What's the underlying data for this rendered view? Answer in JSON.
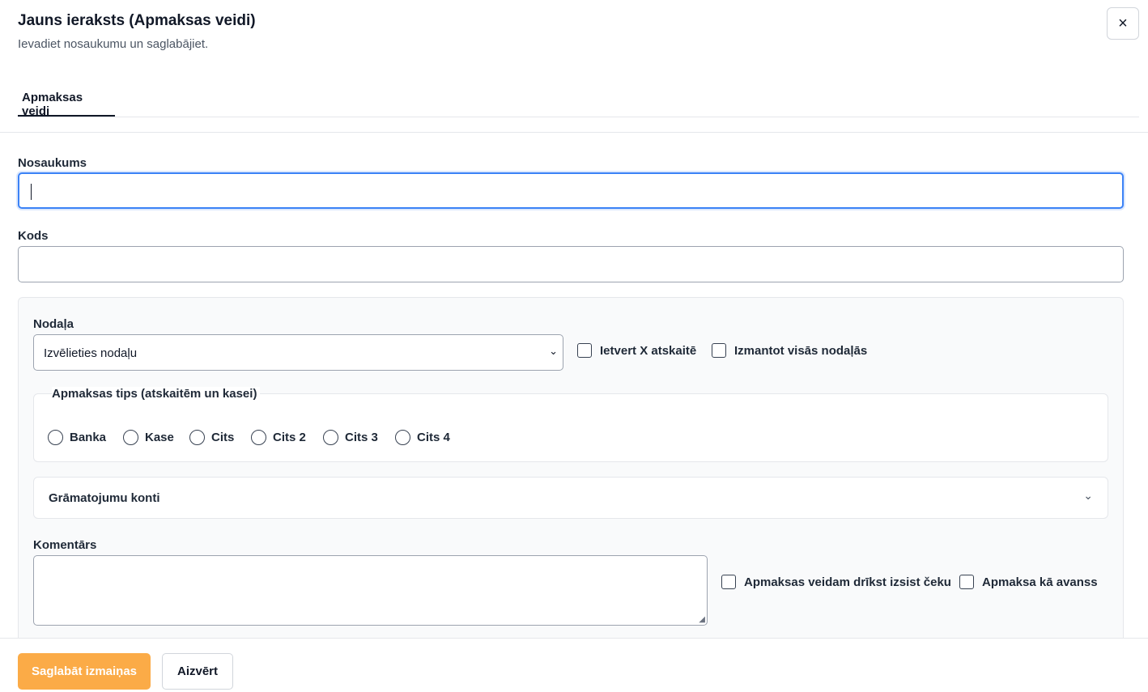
{
  "header": {
    "title": "Jauns ieraksts (Apmaksas veidi)",
    "subtitle": "Ievadiet nosaukumu un saglabājiet.",
    "close_label": "×"
  },
  "tabs": [
    {
      "label": "Apmaksas veidi",
      "active": true
    }
  ],
  "form": {
    "name": {
      "label": "Nosaukums",
      "value": ""
    },
    "code": {
      "label": "Kods",
      "value": ""
    },
    "department": {
      "label": "Nodaļa",
      "selected": "Izvēlieties nodaļu",
      "chevron": "⌄"
    },
    "include_x_report": {
      "label": "Ietvert X atskaitē",
      "checked": false
    },
    "use_all_departments": {
      "label": "Izmantot visās nodaļās",
      "checked": false
    },
    "payment_type": {
      "legend": "Apmaksas tips (atskaitēm un kasei)",
      "options": [
        "Banka",
        "Kase",
        "Cits",
        "Cits 2",
        "Cits 3",
        "Cits 4"
      ],
      "selected": null
    },
    "accounts_accordion": {
      "title": "Grāmatojumu konti",
      "chevron": "⌄",
      "expanded": false
    },
    "comment": {
      "label": "Komentārs",
      "value": ""
    },
    "allow_receipt": {
      "label": "Apmaksas veidam drīkst izsist čeku",
      "checked": false
    },
    "as_advance": {
      "label": "Apmaksa kā avanss",
      "checked": false
    }
  },
  "footer": {
    "save_label": "Saglabāt izmaiņas",
    "close_label": "Aizvērt"
  },
  "colors": {
    "primary": "#fbab47",
    "focus": "#3b82f6",
    "panel_bg": "#f9fafb",
    "border": "#e5e7eb"
  }
}
